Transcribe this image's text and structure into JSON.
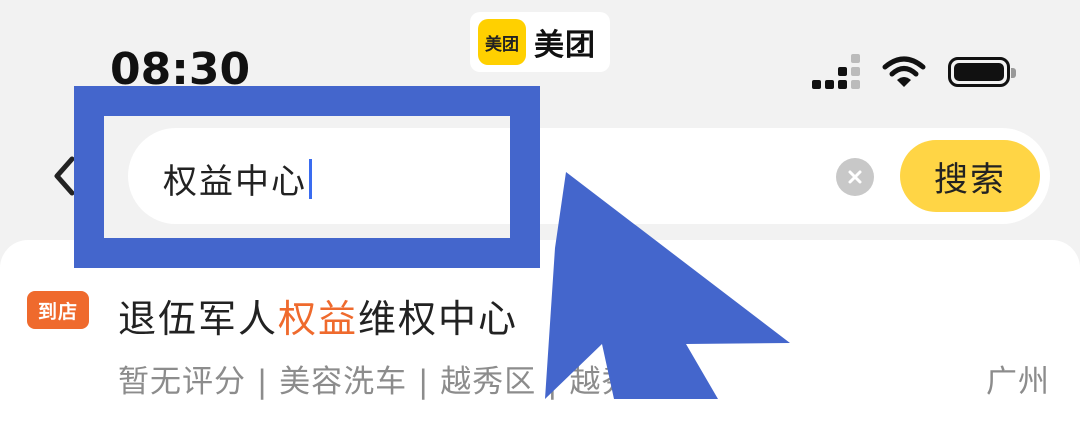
{
  "watermark": {
    "badge_text": "美团",
    "brand_name": "美团"
  },
  "status_bar": {
    "time": "08:30"
  },
  "search": {
    "query": "权益中心",
    "button_label": "搜索"
  },
  "result": {
    "tag": "到店",
    "title_prefix": "退伍军人",
    "title_highlight": "权益",
    "title_suffix": "维权中心",
    "meta": "暂无评分 | 美容洗车 | 越秀区 | 越秀区",
    "city": "广州"
  },
  "colors": {
    "brand_yellow": "#FFD000",
    "search_button": "#FFD545",
    "highlight_orange": "#EF6A2D",
    "annotation_blue": "#4466CC"
  }
}
